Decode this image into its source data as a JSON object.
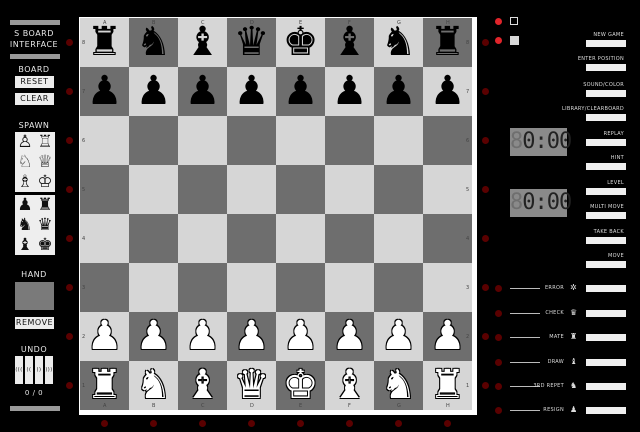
{
  "left_panel": {
    "title_line1": "S BOARD",
    "title_line2": "INTERFACE",
    "board_title": "BOARD",
    "reset_label": "RESET",
    "clear_label": "CLEAR",
    "spawn_title": "SPAWN",
    "hand_title": "HAND",
    "remove_label": "REMOVE",
    "undo_title": "UNDO",
    "undo_buttons": [
      "(((",
      "((",
      "))",
      ")))"
    ],
    "undo_counter": "0 / 0"
  },
  "spawn_white": [
    "♙",
    "♖",
    "♘",
    "♕",
    "♗",
    "♔"
  ],
  "spawn_black": [
    "♟",
    "♜",
    "♞",
    "♛",
    "♝",
    "♚"
  ],
  "board": {
    "files": [
      "A",
      "B",
      "C",
      "D",
      "E",
      "F",
      "G",
      "H"
    ],
    "ranks": [
      "8",
      "7",
      "6",
      "5",
      "4",
      "3",
      "2",
      "1"
    ],
    "rows": [
      [
        "bR",
        "bN",
        "bB",
        "bQ",
        "bK",
        "bB",
        "bN",
        "bR"
      ],
      [
        "bP",
        "bP",
        "bP",
        "bP",
        "bP",
        "bP",
        "bP",
        "bP"
      ],
      [
        "",
        "",
        "",
        "",
        "",
        "",
        "",
        ""
      ],
      [
        "",
        "",
        "",
        "",
        "",
        "",
        "",
        ""
      ],
      [
        "",
        "",
        "",
        "",
        "",
        "",
        "",
        ""
      ],
      [
        "",
        "",
        "",
        "",
        "",
        "",
        "",
        ""
      ],
      [
        "wP",
        "wP",
        "wP",
        "wP",
        "wP",
        "wP",
        "wP",
        "wP"
      ],
      [
        "wR",
        "wN",
        "wB",
        "wQ",
        "wK",
        "wB",
        "wN",
        "wR"
      ]
    ],
    "glyphs": {
      "K": "♚",
      "Q": "♛",
      "R": "♜",
      "B": "♝",
      "N": "♞",
      "P": "♟"
    }
  },
  "right_panel": {
    "menu": [
      "NEW GAME",
      "ENTER POSITION",
      "SOUND/COLOR",
      "LIBRARY/CLEARBOARD",
      "REPLAY",
      "HINT",
      "LEVEL",
      "MULTI MOVE",
      "TAKE BACK",
      "MOVE"
    ],
    "clock_top": {
      "dim": "8",
      "value": "0:00"
    },
    "clock_bottom": {
      "dim": "8",
      "value": "0:00"
    },
    "status": [
      {
        "label": "ERROR",
        "icon": "✲"
      },
      {
        "label": "CHECK",
        "icon": "♛"
      },
      {
        "label": "MATE",
        "icon": "♜"
      },
      {
        "label": "DRAW",
        "icon": "♝"
      },
      {
        "label": "3RD REPET",
        "icon": "♞"
      },
      {
        "label": "RESIGN",
        "icon": "♟"
      }
    ]
  },
  "colors": {
    "led_on": "#e1252b",
    "led_off": "#5a0000",
    "dark_square": "#6e6e6e",
    "light_square": "#d6d6d6"
  }
}
